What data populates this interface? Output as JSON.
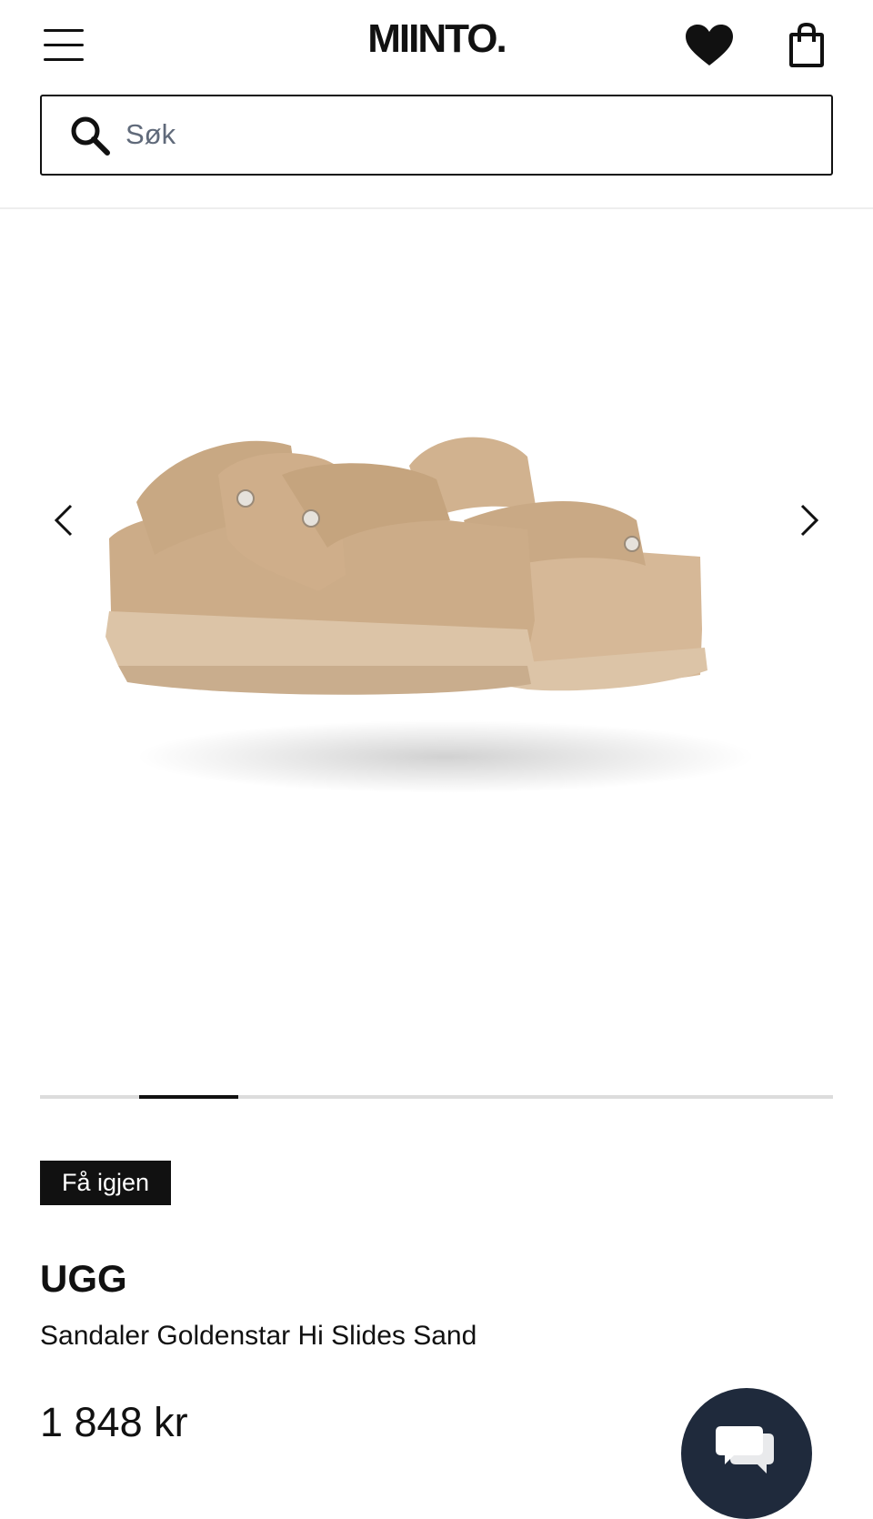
{
  "header": {
    "logo": "MIINTO.",
    "search": {
      "placeholder": "Søk",
      "value": ""
    },
    "icons": [
      "menu-icon",
      "heart-icon",
      "shopping-bag-icon",
      "search-icon"
    ]
  },
  "gallery": {
    "image_count": 8,
    "active_index": 1,
    "icons": [
      "chevron-left-icon",
      "chevron-right-icon"
    ]
  },
  "product": {
    "badge": "Få igjen",
    "brand": "UGG",
    "name": "Sandaler Goldenstar Hi Slides Sand",
    "price": "1 848 kr"
  },
  "chat": {
    "icon": "chat-icon"
  },
  "colors": {
    "accent": "#111111",
    "chat_bg": "#1f2a3c",
    "product": "#d9bd9e"
  }
}
